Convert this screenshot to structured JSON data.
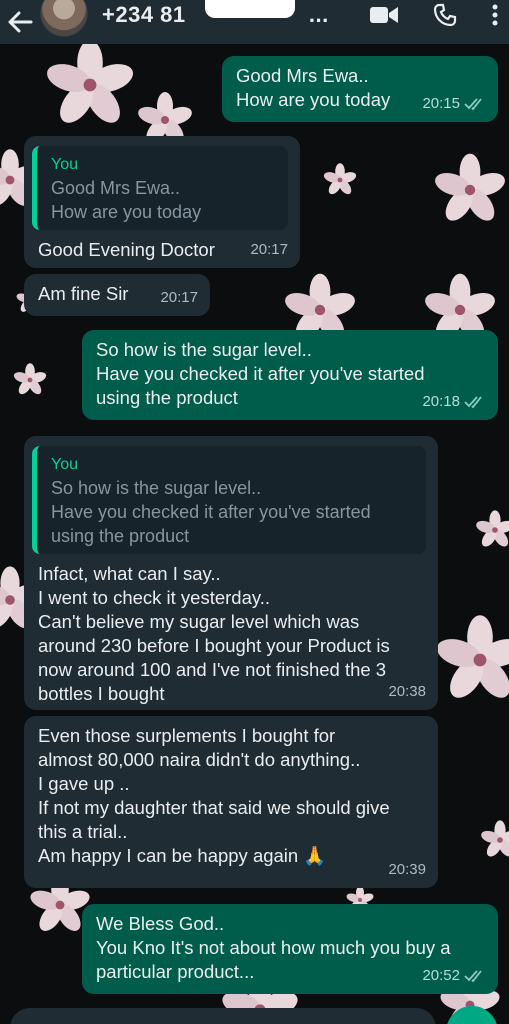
{
  "header": {
    "contact_name": "+234 81",
    "contact_suffix": "...",
    "icons": [
      "back-arrow-icon",
      "video-call-icon",
      "voice-call-icon",
      "more-options-icon"
    ]
  },
  "messages": [
    {
      "dir": "out",
      "text": "Good Mrs Ewa..\nHow are you today",
      "time": "20:15",
      "status": "read"
    },
    {
      "dir": "in",
      "quote": {
        "author": "You",
        "text": "Good Mrs Ewa..\nHow are you today"
      },
      "text": "Good Evening Doctor",
      "time": "20:17"
    },
    {
      "dir": "in",
      "text": "Am fine Sir",
      "time": "20:17"
    },
    {
      "dir": "out",
      "text": "So how is the sugar level..\nHave you checked it after you've started\nusing the product",
      "time": "20:18",
      "status": "read"
    },
    {
      "dir": "in",
      "quote": {
        "author": "You",
        "text": "So how is the sugar level..\nHave you checked it after you've started\nusing the product"
      },
      "text": "Infact, what can I say..\nI went to check it yesterday..\nCan't believe my sugar level which was\naround 230 before I bought your Product is\nnow around 100 and I've not finished the 3\nbottles I bought",
      "time": "20:38"
    },
    {
      "dir": "in",
      "text": "Even those surplements I bought for\nalmost 80,000 naira didn't do anything..\nI gave up ..\nIf not my daughter that said we should give\nthis a trial..\nAm happy I can be happy again 🙏",
      "time": "20:39"
    },
    {
      "dir": "out",
      "text": "We Bless God..\nYou Kno It's not about how much you buy a\nparticular product...",
      "time": "20:52",
      "status": "read"
    }
  ],
  "colors": {
    "outgoing_bubble": "#005c4b",
    "incoming_bubble": "#1f2c34",
    "header": "#1f2c34",
    "quote_accent": "#06cf9c",
    "read_tick": "#53bdeb"
  }
}
